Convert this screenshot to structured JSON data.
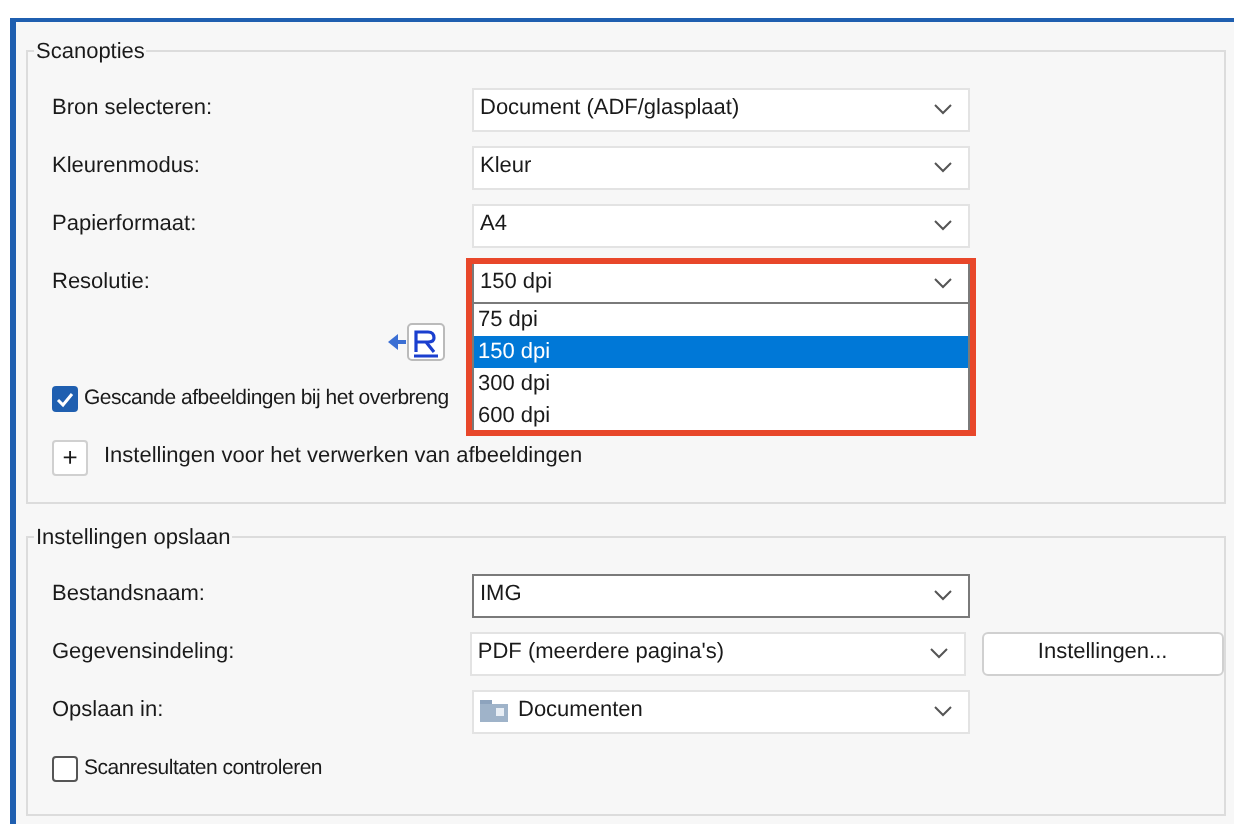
{
  "groups": [
    {
      "title": "Scanopties",
      "rows": [
        {
          "kind": "select",
          "label": "Bron selecteren:",
          "value": "Document (ADF/glasplaat)",
          "focused": false
        },
        {
          "kind": "select",
          "label": "Kleurenmodus:",
          "value": "Kleur",
          "focused": false
        },
        {
          "kind": "select",
          "label": "Papierformaat:",
          "value": "A4",
          "focused": false
        },
        {
          "kind": "select",
          "label": "Resolutie:",
          "value": "150 dpi",
          "focused": false,
          "expanded": true,
          "highlighted": true,
          "options": [
            {
              "label": "75 dpi",
              "selected": false
            },
            {
              "label": "150 dpi",
              "selected": true
            },
            {
              "label": "300 dpi",
              "selected": false
            },
            {
              "label": "600 dpi",
              "selected": false
            }
          ]
        },
        {
          "kind": "image-icon"
        },
        {
          "kind": "checkbox",
          "label": "Gescande afbeeldingen bij het overbreng",
          "checked": true
        },
        {
          "kind": "expander",
          "symbol": "+",
          "label": "Instellingen voor het verwerken van afbeeldingen"
        }
      ]
    },
    {
      "title": "Instellingen opslaan",
      "rows": [
        {
          "kind": "select",
          "label": "Bestandsnaam:",
          "value": "IMG",
          "focused": true
        },
        {
          "kind": "select",
          "label": "Gegevensindeling:",
          "value": "PDF (meerdere pagina's)",
          "focused": false,
          "button": "Instellingen..."
        },
        {
          "kind": "select",
          "label": "Opslaan in:",
          "value": "Documenten",
          "focused": false,
          "folder": true
        },
        {
          "kind": "checkbox",
          "label": "Scanresultaten controleren",
          "checked": false
        }
      ]
    }
  ]
}
